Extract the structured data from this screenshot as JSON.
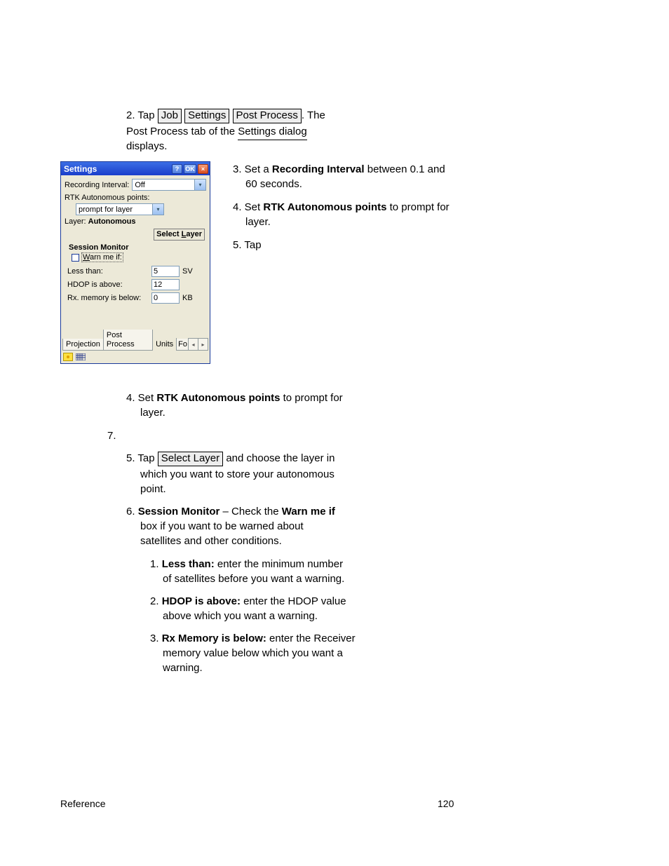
{
  "header": {
    "text_before_buttons": "2. Tap ",
    "btn_job": "Job",
    "btn_settings": "Settings",
    "btn_post_process": "Post Process",
    "text_after_buttons": ". The"
  },
  "line2": "Post Process tab of the Settings dialog",
  "line3": "displays.",
  "line_rec1": "3. Set a Recording Interval between 0.1 and",
  "line_rec2": "60 seconds.",
  "line_rtk1": "4. Set RTK Autonomous points to prompt for",
  "line_rtk2": "layer.",
  "line_sel1_a": "5. Tap ",
  "line_sel1_btn": "Select Layer",
  "line_sel1_b": " and choose the layer in",
  "line_sel2": "which you want to store your autonomous",
  "line_sel3": "point.",
  "line6a": "6. Session Monitor – Check the Warn me if",
  "line6b": "box if you want to be warned about",
  "line6c": "satellites and other conditions.",
  "li1": "1. Less than: enter the minimum number",
  "li1b": "of satellites before you want a warning.",
  "li2": "2. HDOP is above: enter the HDOP value",
  "li2b": "above which you want a warning.",
  "li3": "3. Rx Memory is below: enter the Receiver",
  "li3b": "memory value below which you want a",
  "li3c": "warning.",
  "page_left": "Reference",
  "page_right": "120",
  "dialog": {
    "title": "Settings",
    "help": "?",
    "ok": "OK",
    "close": "×",
    "recording_interval_label": "Recording Interval:",
    "recording_interval_value": "Off",
    "rtk_label": "RTK Autonomous points:",
    "rtk_value": "prompt for layer",
    "layer_label": "Layer:  ",
    "layer_value": "Autonomous",
    "select_layer_btn": "Select Layer",
    "session_monitor": "Session Monitor",
    "warn_me_if": "Warn me if:",
    "less_than": "Less than:",
    "less_than_val": "5",
    "less_than_unit": "SV",
    "hdop": "HDOP is above:",
    "hdop_val": "12",
    "rx": "Rx. memory is below:",
    "rx_val": "0",
    "rx_unit": "KB",
    "tab1": "Projection",
    "tab2": "Post Process",
    "tab3": "Units",
    "tab4": "Fo"
  }
}
